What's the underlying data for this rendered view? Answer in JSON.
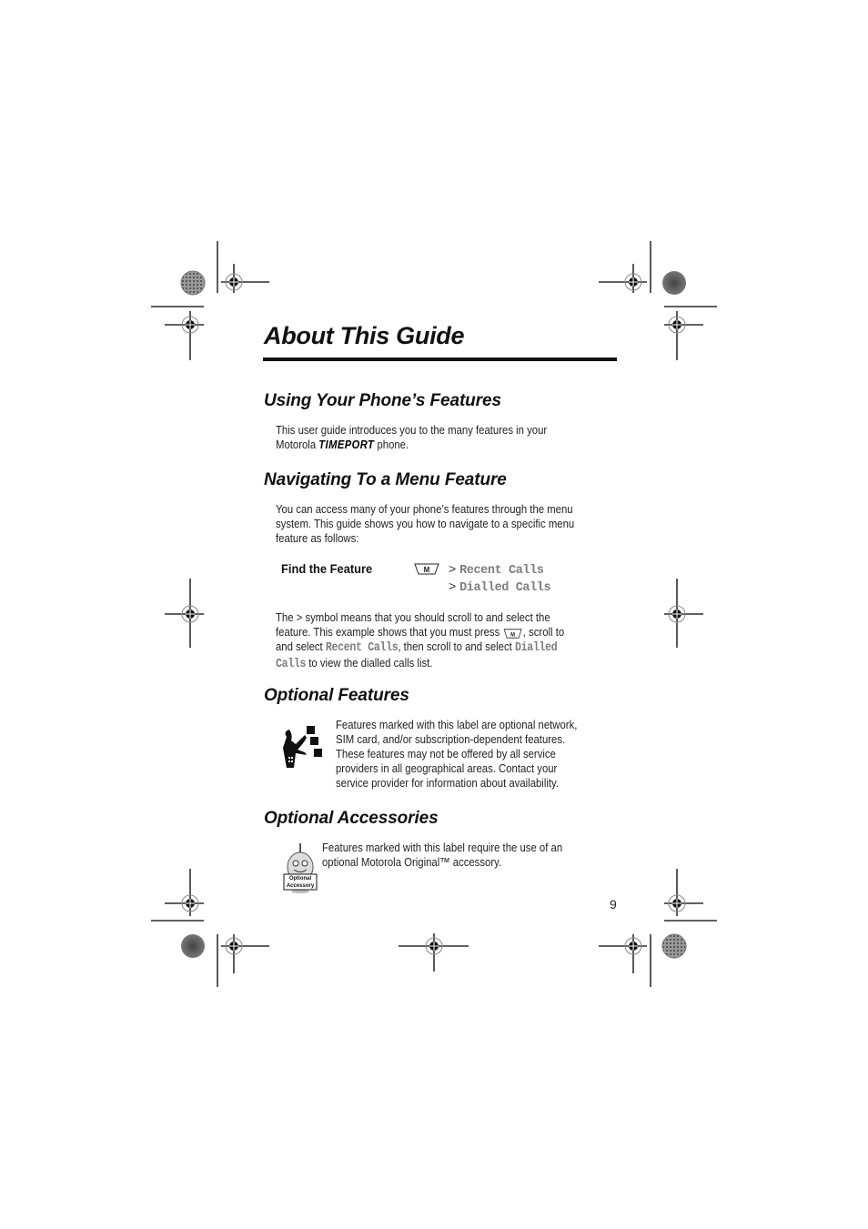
{
  "page": {
    "title": "About This Guide",
    "page_number": "9"
  },
  "sections": {
    "using": {
      "heading": "Using Your Phone’s Features",
      "line1": "This user guide introduces you to the many features in your",
      "line2_pre": "Motorola",
      "brand": "TIMEPORT",
      "line2_post": "phone."
    },
    "navigating": {
      "heading": "Navigating To a Menu Feature",
      "lines": [
        "You can access many of your phone’s features through the menu",
        "system. This guide shows you how to navigate to a specific menu",
        "feature as follows:"
      ],
      "find_feature": {
        "label": "Find the Feature",
        "menu_key_icon": "menu-key-icon",
        "menu_key_label": "M",
        "steps": [
          {
            "symbol": ">",
            "item": "Recent Calls"
          },
          {
            "symbol": ">",
            "item": "Dialled Calls"
          }
        ]
      },
      "explain": {
        "line1": "The > symbol means that you should scroll to and select the",
        "line2_pre": "feature. This example shows that you must press",
        "line2_post": ", scroll to",
        "line3_pre": "and select",
        "line3_item1": "Recent Calls",
        "line3_mid": ", then scroll to and select",
        "line3_item2a": "Dialled",
        "line4_item2b": "Calls",
        "line4_post": "to view the dialled calls list."
      }
    },
    "optional_features": {
      "heading": "Optional Features",
      "icon": "network-feature-icon",
      "lines": [
        "Features marked with this label are optional network,",
        "SIM card, and/or subscription-dependent features.",
        "These features may not be offered by all service",
        "providers in all geographical areas. Contact your",
        "service provider for information about availability."
      ]
    },
    "optional_accessories": {
      "heading": "Optional Accessories",
      "icon": "optional-accessory-icon",
      "icon_label_line1": "Optional",
      "icon_label_line2": "Accessory",
      "lines": [
        "Features marked with this label require the use of an",
        "optional Motorola Original™ accessory."
      ]
    }
  },
  "colors": {
    "text": "#222222",
    "heading": "#111111",
    "menu_item": "#7d7d7d"
  }
}
